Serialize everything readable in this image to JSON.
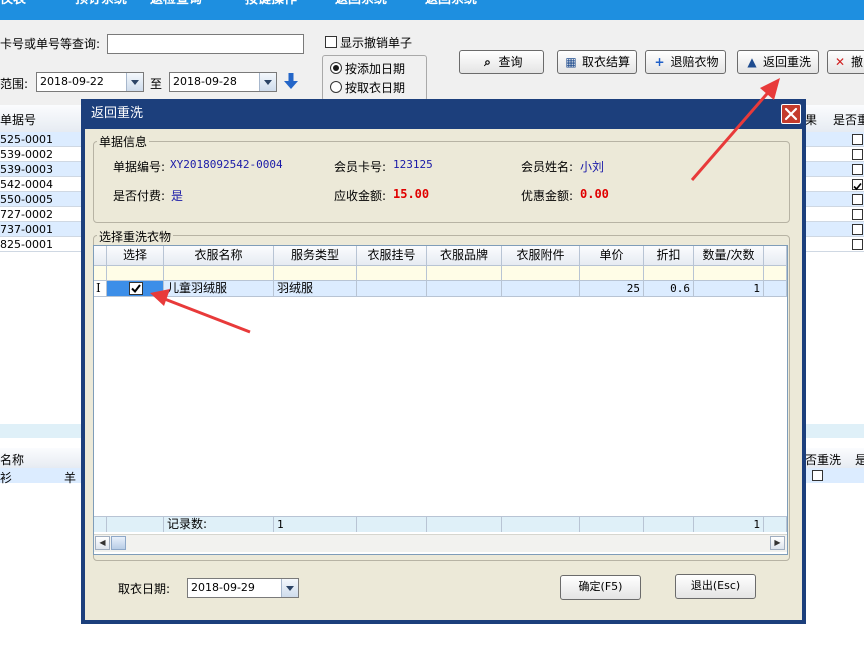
{
  "nav": [
    "仪表",
    "预订系统",
    "返检查询",
    "按键操作",
    "返回系统",
    "返回系统"
  ],
  "query": {
    "card_label": "卡号或单号等查询:",
    "card_value": "",
    "show_cancelled_label": "显示撤销单子",
    "range_label": "范围:",
    "date_from": "2018-09-22",
    "to_label": "至",
    "date_to": "2018-09-28",
    "radio_add_date": "按添加日期",
    "radio_take_date": "按取衣日期"
  },
  "buttons": {
    "search": "查询",
    "settle": "取衣结算",
    "refund": "退赔衣物",
    "rewash": "返回重洗",
    "cancel": "撤"
  },
  "bg_table": {
    "header": "单据号",
    "rows": [
      "525-0001",
      "539-0002",
      "539-0003",
      "542-0004",
      "550-0005",
      "727-0002",
      "737-0001",
      "825-0001"
    ],
    "right_header_1": "果",
    "right_header_2": "是否重",
    "right_checked": [
      false,
      false,
      false,
      true,
      false,
      false,
      false,
      false
    ],
    "bottom_header_left": "名称",
    "bottom_cell_left": "衫",
    "bottom_cell_mid": "羊",
    "bottom_header_right_1": "否重洗",
    "bottom_header_right_2": "是"
  },
  "dialog": {
    "title": "返回重洗",
    "info_group": "单据信息",
    "order_no_label": "单据编号:",
    "order_no": "XY2018092542-0004",
    "card_no_label": "会员卡号:",
    "card_no": "123125",
    "member_name_label": "会员姓名:",
    "member_name": "小刘",
    "paid_label": "是否付费:",
    "paid": "是",
    "amount_due_label": "应收金额:",
    "amount_due": "15.00",
    "discount_label": "优惠金额:",
    "discount": "0.00",
    "clothes_group": "选择重洗衣物",
    "columns": [
      "选择",
      "衣服名称",
      "服务类型",
      "衣服挂号",
      "衣服品牌",
      "衣服附件",
      "单价",
      "折扣",
      "数量/次数"
    ],
    "row": {
      "indicator": "I",
      "selected": true,
      "name": "儿童羽绒服",
      "service": "羽绒服",
      "hook_no": "",
      "brand": "",
      "attachment": "",
      "price": "25",
      "discount": "0.6",
      "qty": "1"
    },
    "total_label": "记录数:",
    "total_count": "1",
    "total_qty": "1",
    "take_date_label": "取衣日期:",
    "take_date": "2018-09-29",
    "ok_button": "确定(F5)",
    "exit_button": "退出(Esc)"
  },
  "colors": {
    "topbar": "#1e8fe0",
    "dialog_frame": "#1c3f7c",
    "close_button": "#c43b2c",
    "annotation_arrow": "#e83a3a"
  }
}
